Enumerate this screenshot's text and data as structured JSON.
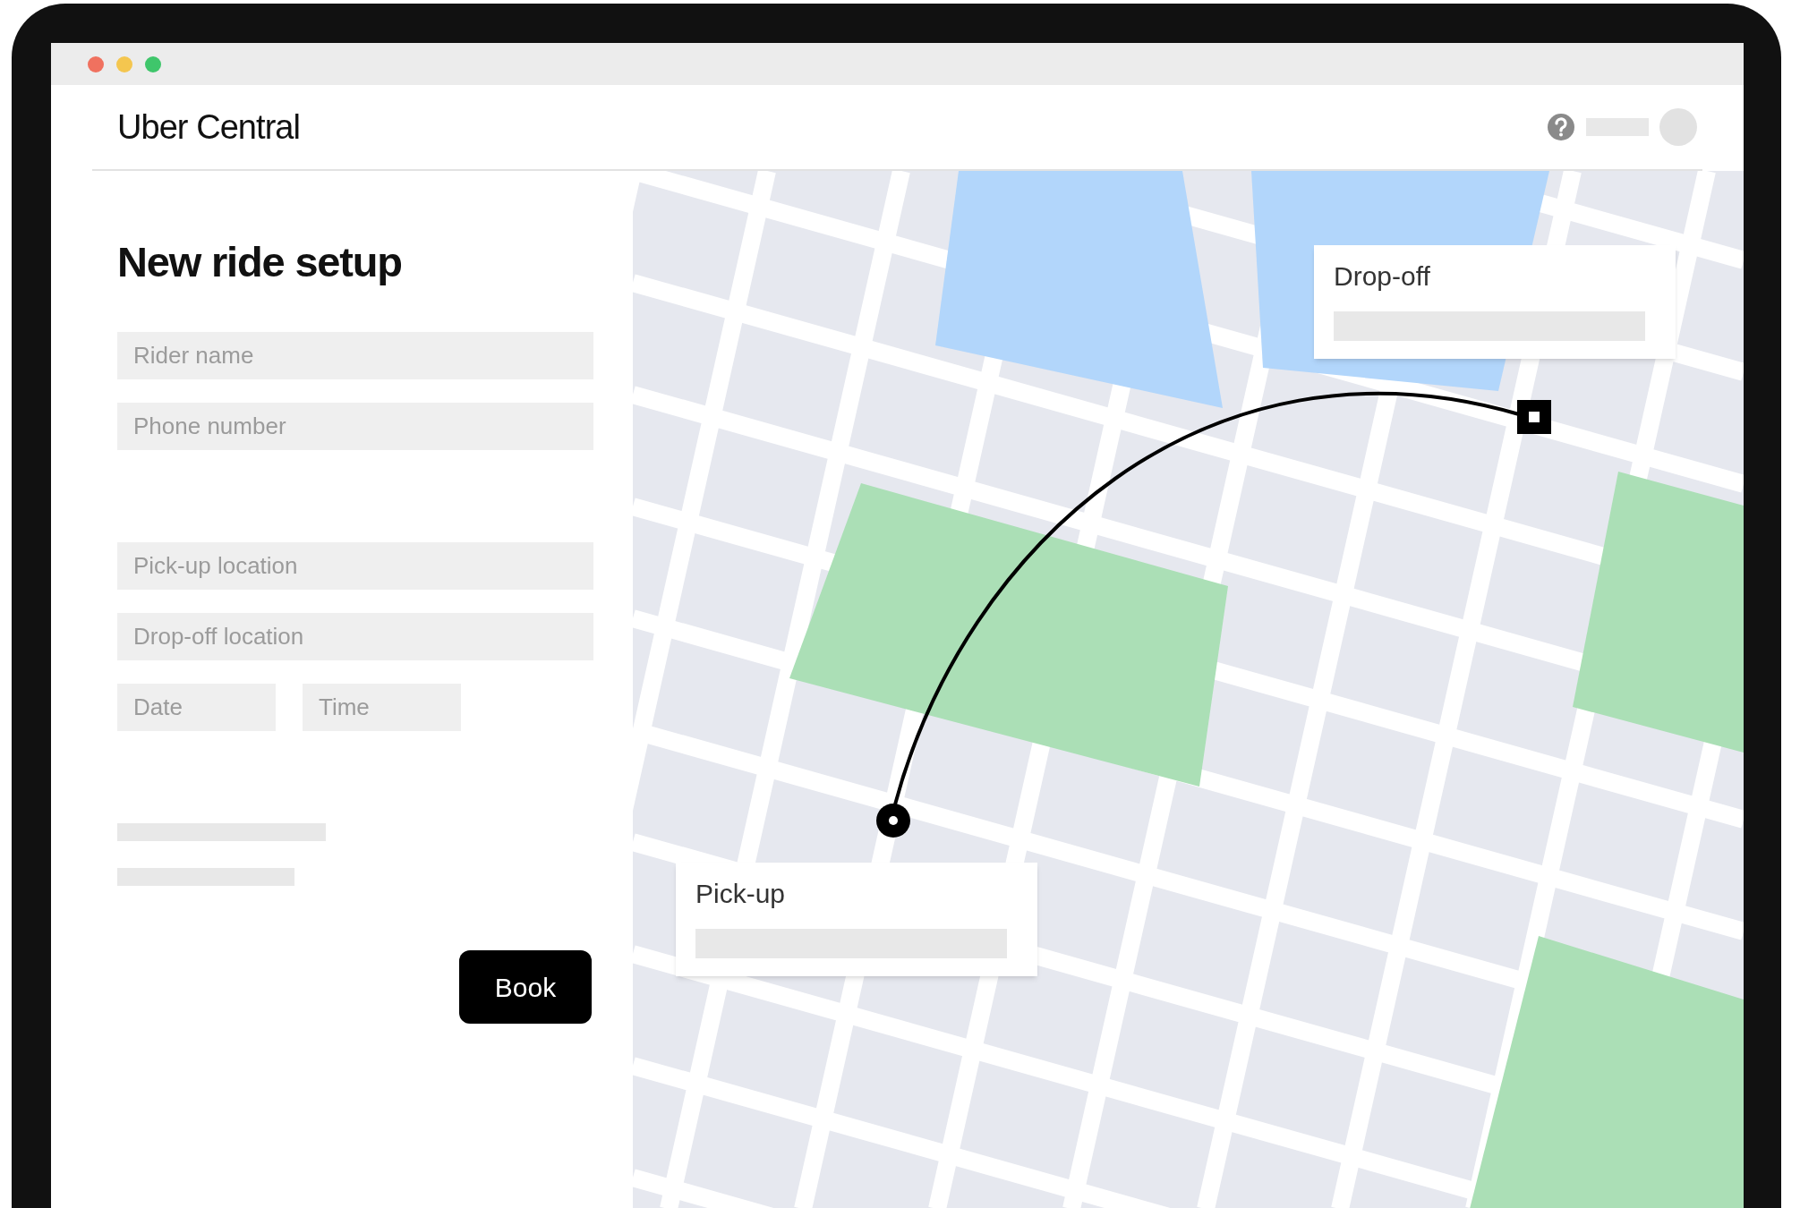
{
  "app": {
    "title": "Uber Central"
  },
  "form": {
    "heading": "New ride setup",
    "fields": [
      {
        "placeholder": "Rider name"
      },
      {
        "placeholder": "Phone number"
      },
      {
        "placeholder": "Pick-up location"
      },
      {
        "placeholder": "Drop-off location"
      }
    ],
    "date_time": [
      {
        "placeholder": "Date"
      },
      {
        "placeholder": "Time"
      }
    ],
    "button": "Book"
  },
  "map": {
    "pickup": {
      "label": "Pick-up"
    },
    "dropoff": {
      "label": "Drop-off"
    }
  }
}
